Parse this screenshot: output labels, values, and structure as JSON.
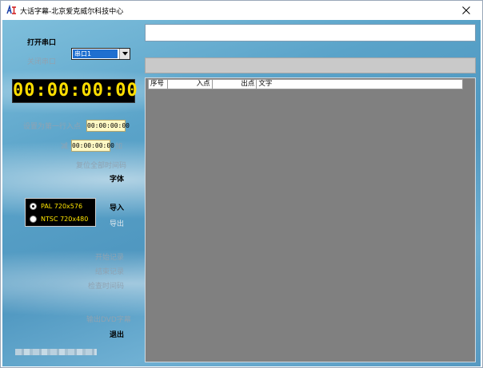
{
  "window": {
    "title": "大话字幕-北京爱克威尔科技中心",
    "icon": "app-logo-icon",
    "close_glyph": "✕"
  },
  "left_panel": {
    "open_port": "打开串口",
    "close_port": "关闭串口",
    "port_select": {
      "selected": "串口1"
    },
    "timecode": "00:00:00:00",
    "set_first_in_label": "设置为第一行入点",
    "set_first_in_value": "00:00:00:00",
    "minus_label": "减",
    "offset_value": "00:00:00:00",
    "plus_label": "加",
    "reset_timecode": "复位全部时间码",
    "font": "字体",
    "format_options": [
      {
        "label": "PAL 720x576",
        "checked": true
      },
      {
        "label": "NTSC 720x480",
        "checked": false
      }
    ],
    "import": "导入",
    "export": "导出",
    "start_record": "开始记录",
    "end_record": "结束记录",
    "check_timecode": "检查时间码",
    "output_dvd": "输出DVD字幕",
    "exit": "退出"
  },
  "subtitle_input": {
    "value": ""
  },
  "table": {
    "columns": [
      "序号",
      "入点",
      "出点",
      "文字"
    ],
    "rows": []
  },
  "colors": {
    "timecode_fg": "#ffde00",
    "table_bg": "#808080",
    "panel_bg": "#5aa3c9"
  }
}
